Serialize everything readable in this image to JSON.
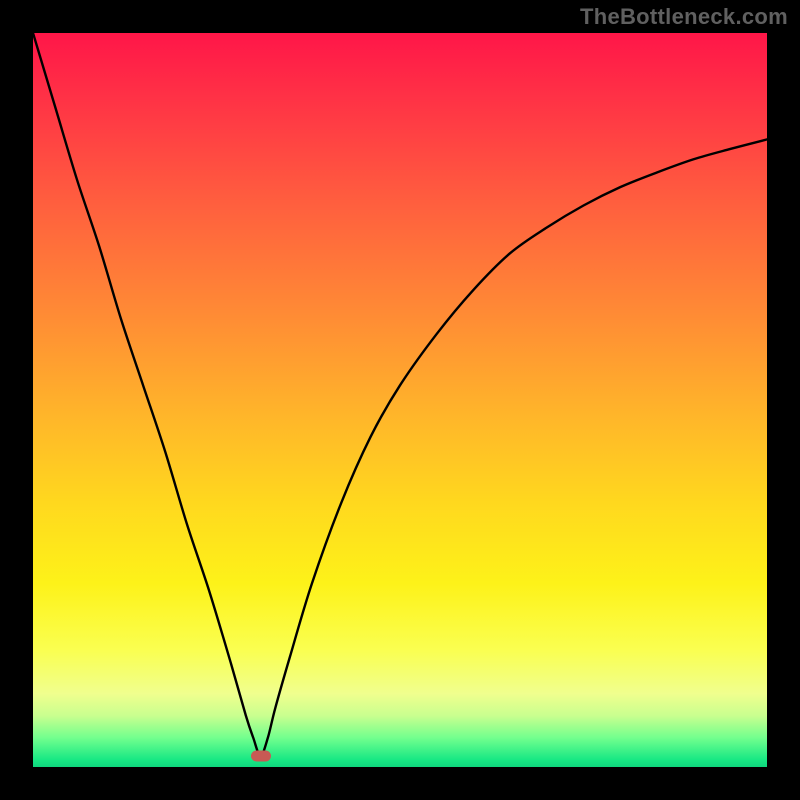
{
  "watermark": "TheBottleneck.com",
  "colors": {
    "frame": "#000000",
    "curve": "#000000",
    "marker": "#c85a54",
    "gradient_top": "#ff1648",
    "gradient_bottom": "#0fd67e"
  },
  "chart_data": {
    "type": "line",
    "title": "",
    "xlabel": "",
    "ylabel": "",
    "xlim": [
      0,
      100
    ],
    "ylim": [
      0,
      100
    ],
    "axes_visible": false,
    "grid": false,
    "legend": false,
    "annotations": [
      {
        "text": "TheBottleneck.com",
        "position": "top-right"
      }
    ],
    "marker": {
      "x": 31,
      "y": 1.5,
      "shape": "rounded-rect",
      "color": "#c85a54"
    },
    "series": [
      {
        "name": "bottleneck-curve",
        "color": "#000000",
        "x": [
          0,
          3,
          6,
          9,
          12,
          15,
          18,
          21,
          24,
          27,
          29,
          30,
          31,
          32,
          33,
          35,
          38,
          42,
          46,
          50,
          55,
          60,
          65,
          70,
          75,
          80,
          85,
          90,
          95,
          100
        ],
        "y": [
          100,
          90,
          80,
          71,
          61,
          52,
          43,
          33,
          24,
          14,
          7,
          4,
          1.5,
          4,
          8,
          15,
          25,
          36,
          45,
          52,
          59,
          65,
          70,
          73.5,
          76.5,
          79,
          81,
          82.8,
          84.2,
          85.5
        ]
      }
    ]
  }
}
